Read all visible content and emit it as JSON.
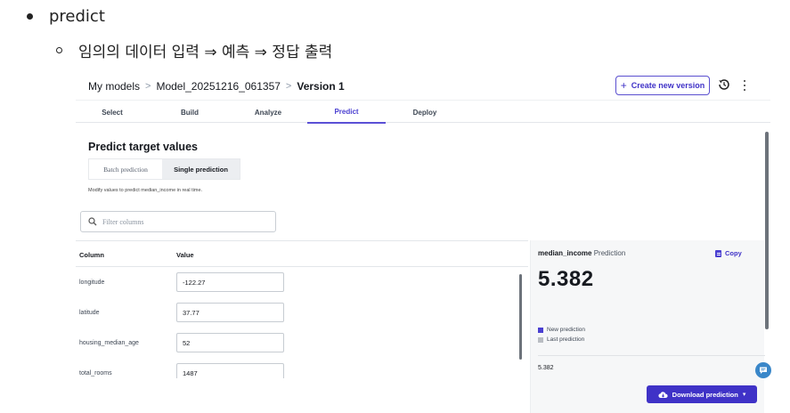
{
  "doc": {
    "bullet1": "predict",
    "bullet2": "임의의 데이터 입력 ⇒ 예측 ⇒ 정답 출력"
  },
  "breadcrumb": {
    "items": [
      "My models",
      "Model_20251216_061357",
      "Version 1"
    ]
  },
  "header": {
    "create_button": "Create new version",
    "icons": [
      "history-icon",
      "more-vertical-icon"
    ]
  },
  "tabs": [
    "Select",
    "Build",
    "Analyze",
    "Predict",
    "Deploy"
  ],
  "active_tab": "Predict",
  "predict": {
    "title": "Predict target values",
    "segment": [
      "Batch prediction",
      "Single prediction"
    ],
    "segment_selected": "Single prediction",
    "hint": "Modify values to predict median_income in real time.",
    "filter_placeholder": "Filter columns"
  },
  "table": {
    "headers": [
      "Column",
      "Value"
    ],
    "rows": [
      {
        "name": "longitude",
        "value": "-122.27"
      },
      {
        "name": "latitude",
        "value": "37.77"
      },
      {
        "name": "housing_median_age",
        "value": "52"
      },
      {
        "name": "total_rooms",
        "value": "1487"
      }
    ]
  },
  "prediction": {
    "target": "median_income",
    "label": "Prediction",
    "copy": "Copy",
    "value": "5.382",
    "legend": [
      {
        "label": "New prediction",
        "color": "#4a3fd1"
      },
      {
        "label": "Last prediction",
        "color": "#b9bdc3"
      }
    ],
    "row_value": "5.382"
  },
  "download_button": "Download prediction",
  "colors": {
    "accent": "#3f32c7"
  }
}
